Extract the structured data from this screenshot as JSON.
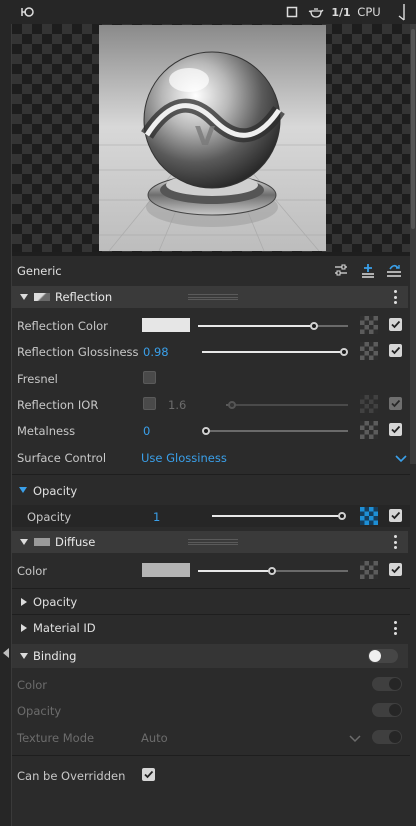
{
  "toolbar": {
    "frame_label": "1/1",
    "render_mode": "CPU"
  },
  "panel": {
    "mode_label": "Generic"
  },
  "reflection": {
    "header": "Reflection",
    "color_label": "Reflection Color",
    "color_swatch": "#e6e6e6",
    "color_slider": 0.78,
    "glossiness_label": "Reflection Glossiness",
    "glossiness_value": "0.98",
    "glossiness_slider": 0.98,
    "fresnel_label": "Fresnel",
    "fresnel_checked": false,
    "ior_label": "Reflection IOR",
    "ior_value": "1.6",
    "ior_slider": 0.06,
    "metalness_label": "Metalness",
    "metalness_value": "0",
    "metalness_slider": 0.0,
    "surface_label": "Surface Control",
    "surface_value": "Use Glossiness"
  },
  "opacity_section": {
    "header": "Opacity",
    "label": "Opacity",
    "value": "1",
    "slider": 1.0
  },
  "diffuse": {
    "header": "Diffuse",
    "color_label": "Color",
    "color_swatch": "#b4b4b4",
    "color_slider": 0.5
  },
  "collapsed": {
    "opacity_label": "Opacity",
    "material_id_label": "Material ID"
  },
  "binding": {
    "header": "Binding",
    "color_label": "Color",
    "opacity_label": "Opacity",
    "texture_mode_label": "Texture Mode",
    "texture_mode_value": "Auto",
    "overridden_label": "Can be Overridden",
    "overridden_checked": true
  }
}
